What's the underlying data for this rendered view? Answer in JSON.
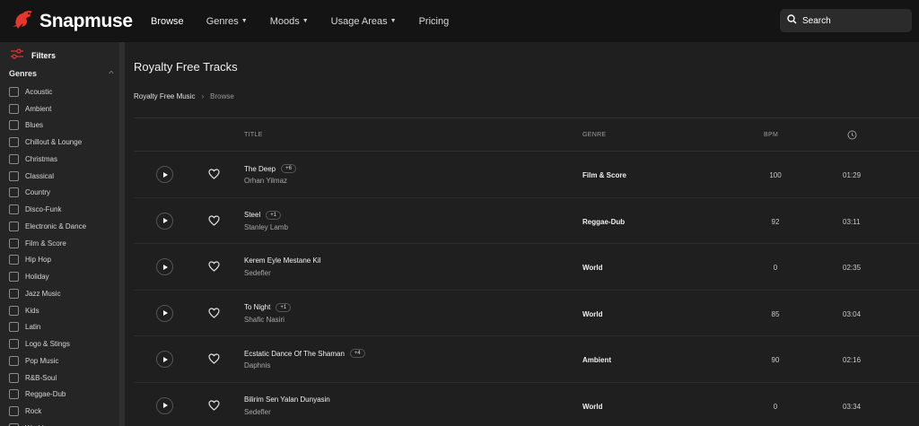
{
  "header": {
    "logo": "Snapmuse",
    "nav": [
      {
        "label": "Browse",
        "dropdown": false
      },
      {
        "label": "Genres",
        "dropdown": true
      },
      {
        "label": "Moods",
        "dropdown": true
      },
      {
        "label": "Usage Areas",
        "dropdown": true
      },
      {
        "label": "Pricing",
        "dropdown": false
      }
    ],
    "search_label": "Search"
  },
  "sidebar": {
    "filters_label": "Filters",
    "genres_label": "Genres",
    "genres": [
      "Acoustic",
      "Ambient",
      "Blues",
      "Chillout & Lounge",
      "Christmas",
      "Classical",
      "Country",
      "Disco-Funk",
      "Electronic & Dance",
      "Film & Score",
      "Hip Hop",
      "Holiday",
      "Jazz Music",
      "Kids",
      "Latin",
      "Logo & Stings",
      "Pop Music",
      "R&B-Soul",
      "Reggae-Dub",
      "Rock",
      "World"
    ]
  },
  "main": {
    "title": "Royalty Free Tracks",
    "breadcrumb": {
      "link": "Royalty Free Music",
      "separator": "›",
      "current": "Browse"
    },
    "columns": {
      "title": "TITLE",
      "genre": "GENRE",
      "bpm": "BPM"
    },
    "tracks": [
      {
        "title": "The Deep",
        "extra": "+6",
        "artist": "Orhan Yilmaz",
        "genre": "Film & Score",
        "bpm": "100",
        "duration": "01:29"
      },
      {
        "title": "Steel",
        "extra": "+1",
        "artist": "Stanley Lamb",
        "genre": "Reggae-Dub",
        "bpm": "92",
        "duration": "03:11"
      },
      {
        "title": "Kerem Eyle Mestane Kil",
        "extra": "",
        "artist": "Sedefler",
        "genre": "World",
        "bpm": "0",
        "duration": "02:35"
      },
      {
        "title": "To Night",
        "extra": "+1",
        "artist": "Shafic Nasiri",
        "genre": "World",
        "bpm": "85",
        "duration": "03:04"
      },
      {
        "title": "Ecstatic Dance Of The Shaman",
        "extra": "+4",
        "artist": "Daphnis",
        "genre": "Ambient",
        "bpm": "90",
        "duration": "02:16"
      },
      {
        "title": "Bilirim Sen Yalan Dunyasin",
        "extra": "",
        "artist": "Sedefler",
        "genre": "World",
        "bpm": "0",
        "duration": "03:34"
      }
    ]
  },
  "colors": {
    "brand_red": "#e8352e",
    "background": "#1e1e1e",
    "topbar": "#141414"
  },
  "icons": [
    "logo-icon",
    "search-icon",
    "filters-icon",
    "chevron-up-icon",
    "clock-icon",
    "play-icon",
    "heart-icon"
  ]
}
